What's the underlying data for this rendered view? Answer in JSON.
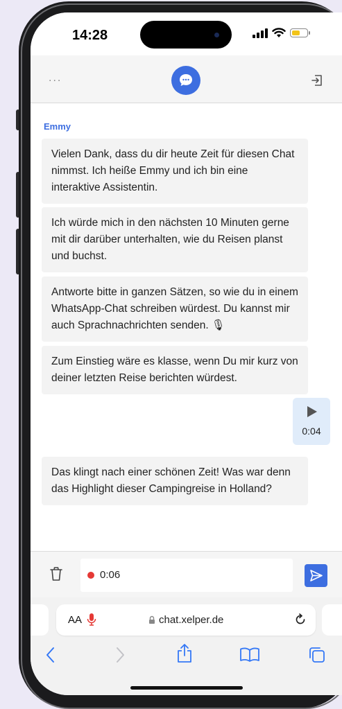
{
  "status_bar": {
    "time": "14:28",
    "battery_fraction": 0.55,
    "icons": [
      "cellular-signal-icon",
      "wifi-icon",
      "battery-icon"
    ]
  },
  "app_header": {
    "menu_label": "...",
    "logo_icon": "chat-bubble-icon",
    "exit_icon": "exit-icon"
  },
  "chat": {
    "sender": "Emmy",
    "messages": [
      {
        "text": "Vielen Dank, dass du dir heute Zeit für diesen Chat nimmst. Ich heiße Emmy und ich bin eine interaktive Assistentin."
      },
      {
        "text": "Ich würde mich in den nächsten 10 Minuten gerne mit dir darüber unterhalten, wie du Reisen planst und buchst."
      },
      {
        "text": "Antworte bitte in ganzen Sätzen, so wie du in einem WhatsApp-Chat schreiben würdest. Du kannst mir auch Sprachnachrichten senden. 🎙"
      },
      {
        "text": "Zum Einstieg wäre es klasse, wenn Du mir kurz von deiner letzten Reise berichten würdest."
      },
      {
        "text": "Das klingt nach einer schönen Zeit! Was war denn das Highlight dieser Campingreise in Holland?"
      }
    ],
    "voice_message": {
      "duration": "0:04"
    }
  },
  "input_bar": {
    "recording_time": "0:06"
  },
  "safari": {
    "aa_label": "AA",
    "url": "chat.xelper.de"
  },
  "colors": {
    "accent": "#3d6ee0",
    "recording": "#e53935",
    "bubble": "#f3f3f3",
    "voice_bubble": "#e0ecfa",
    "background": "#ece9f6"
  }
}
